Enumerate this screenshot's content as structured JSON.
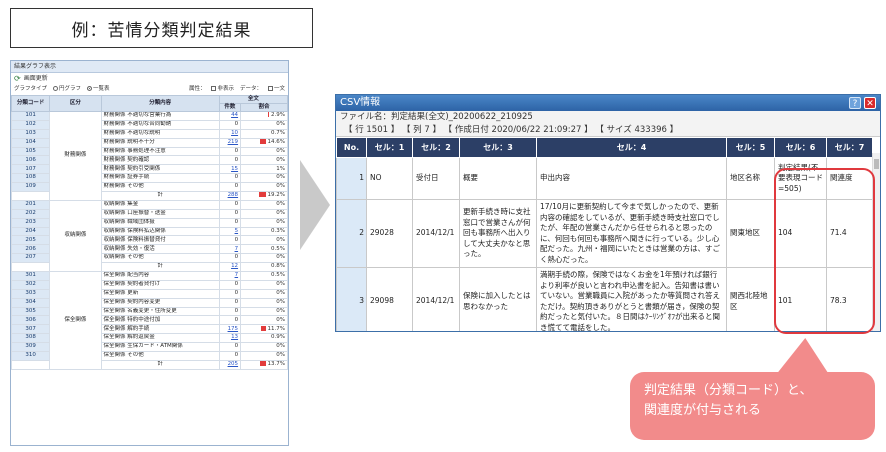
{
  "title": "例：苦情分類判定結果",
  "left_panel": {
    "header": "結果グラフ表示",
    "refresh_label": "画面更新",
    "graph_type_label": "グラフタイプ",
    "pie_label": "円グラフ",
    "list_label": "一覧表",
    "attr_label": "属性：",
    "hide_label": "非表示",
    "data_label": "データ：",
    "one_sentence_label": "一文",
    "columns": {
      "code": "分類コード",
      "category": "区分",
      "content": "分類内容",
      "all": "全文",
      "count": "件数",
      "pct": "割合"
    },
    "groups": [
      {
        "category": "財務関係",
        "rows": [
          {
            "code": "101",
            "content": "財務関係 不適切な営業行為",
            "count": "44",
            "pct": "2.9%",
            "bar": 0.1
          },
          {
            "code": "102",
            "content": "財務関係 不適切な合同勧誘",
            "count": "0",
            "pct": "0%",
            "bar": 0
          },
          {
            "code": "103",
            "content": "財務関係 不適切な説明",
            "count": "10",
            "pct": "0.7%",
            "bar": 0
          },
          {
            "code": "104",
            "content": "財務関係 説明不十分",
            "count": "219",
            "pct": "14.6%",
            "bar": 0.5
          },
          {
            "code": "105",
            "content": "財務関係 事務処理不注意",
            "count": "0",
            "pct": "0%",
            "bar": 0
          },
          {
            "code": "106",
            "content": "財務関係 契約確認",
            "count": "0",
            "pct": "0%",
            "bar": 0
          },
          {
            "code": "107",
            "content": "財務関係 契約引受関係",
            "count": "15",
            "pct": "1%",
            "bar": 0
          },
          {
            "code": "108",
            "content": "財務関係 証券手続",
            "count": "0",
            "pct": "0%",
            "bar": 0
          },
          {
            "code": "109",
            "content": "財務関係 その他",
            "count": "0",
            "pct": "0%",
            "bar": 0
          }
        ],
        "total_label": "計",
        "total": "288",
        "total_pct": "19.2%",
        "total_bar": 0.6
      },
      {
        "category": "収納関係",
        "rows": [
          {
            "code": "201",
            "content": "収納関係 集金",
            "count": "0",
            "pct": "0%",
            "bar": 0
          },
          {
            "code": "202",
            "content": "収納関係 口座振替・送金",
            "count": "0",
            "pct": "0%",
            "bar": 0
          },
          {
            "code": "203",
            "content": "収納関係 職域団体扱",
            "count": "0",
            "pct": "0%",
            "bar": 0
          },
          {
            "code": "204",
            "content": "収納関係 保険料払込関係",
            "count": "5",
            "pct": "0.3%",
            "bar": 0
          },
          {
            "code": "205",
            "content": "収納関係 保険料振替貸付",
            "count": "0",
            "pct": "0%",
            "bar": 0
          },
          {
            "code": "206",
            "content": "収納関係 失効・復活",
            "count": "7",
            "pct": "0.5%",
            "bar": 0
          },
          {
            "code": "207",
            "content": "収納関係 その他",
            "count": "0",
            "pct": "0%",
            "bar": 0
          }
        ],
        "total_label": "計",
        "total": "12",
        "total_pct": "0.8%",
        "total_bar": 0
      },
      {
        "category": "保全関係",
        "rows": [
          {
            "code": "301",
            "content": "保全関係 配当内容",
            "count": "7",
            "pct": "0.5%",
            "bar": 0
          },
          {
            "code": "302",
            "content": "保全関係 契約者貸付け",
            "count": "0",
            "pct": "0%",
            "bar": 0
          },
          {
            "code": "303",
            "content": "保全関係 更新",
            "count": "0",
            "pct": "0%",
            "bar": 0
          },
          {
            "code": "304",
            "content": "保全関係 契約内容変更",
            "count": "0",
            "pct": "0%",
            "bar": 0
          },
          {
            "code": "305",
            "content": "保全関係 名義変更・住所変更",
            "count": "0",
            "pct": "0%",
            "bar": 0
          },
          {
            "code": "306",
            "content": "保全関係 特約中途付加",
            "count": "0",
            "pct": "0%",
            "bar": 0
          },
          {
            "code": "307",
            "content": "保全関係 解約手続",
            "count": "175",
            "pct": "11.7%",
            "bar": 0.4
          },
          {
            "code": "308",
            "content": "保全関係 解約返戻金",
            "count": "13",
            "pct": "0.9%",
            "bar": 0
          },
          {
            "code": "309",
            "content": "保全関係 生保カード・ATM関係",
            "count": "0",
            "pct": "0%",
            "bar": 0
          },
          {
            "code": "310",
            "content": "保全関係 その他",
            "count": "0",
            "pct": "0%",
            "bar": 0
          }
        ],
        "total_label": "計",
        "total": "205",
        "total_pct": "13.7%",
        "total_bar": 0.5
      }
    ]
  },
  "right_panel": {
    "title": "CSV情報",
    "file_label": "ファイル名：判定結果(全文)_20200622_210925",
    "meta": "【 行 1501 】 【 列 7 】 【 作成日付 2020/06/22 21:09:27 】 【 サイズ 433396 】",
    "headers": [
      "No.",
      "セル：1",
      "セル：2",
      "セル：3",
      "セル：4",
      "セル：5",
      "セル：6",
      "セル：7"
    ],
    "rows": [
      {
        "no": "1",
        "c1": "NO",
        "c2": "受付日",
        "c3": "概要",
        "c4": "申出内容",
        "c5": "地区名称",
        "c6": "判定結果(不要表現コード=505)",
        "c7": "関連度"
      },
      {
        "no": "2",
        "c1": "29028",
        "c2": "2014/12/1",
        "c3": "更新手続き時に支社窓口で営業さんが何回も事務所へ出入りして大丈夫かなと思った。",
        "c4": "17/10月に更新契約して今まで気しかったので、更新内容の確認をしているが、更新手続き時支社窓口でしたが、年配の営業さんだから任せられると思ったのに、何回も何回も事務所へ聞きに行っている。少し心配だった。九州・福岡にいたときは営業の方は、すごく熱心だった。",
        "c5": "関東地区",
        "c6": "104",
        "c7": "71.4"
      },
      {
        "no": "3",
        "c1": "29098",
        "c2": "2014/12/1",
        "c3": "保険に加入したとは思わなかった",
        "c4": "満期手続の際，保険ではなくお金を1年預ければ銀行より利率が良いと言われ申込書を記入。告知書は書いていない。営業職員に入院があったか等質問され答えただけ。契約頂きありがとうと書類が届き，保険の契約だったと気付いた。８日間はｸｰﾘﾝｸﾞｵﾌが出来ると聞き慌てて電話をした。",
        "c5": "関西北陸地区",
        "c6": "101",
        "c7": "78.3"
      }
    ]
  },
  "callout": {
    "line1": "判定結果（分類コード）と、",
    "line2": "関連度が付与される"
  }
}
